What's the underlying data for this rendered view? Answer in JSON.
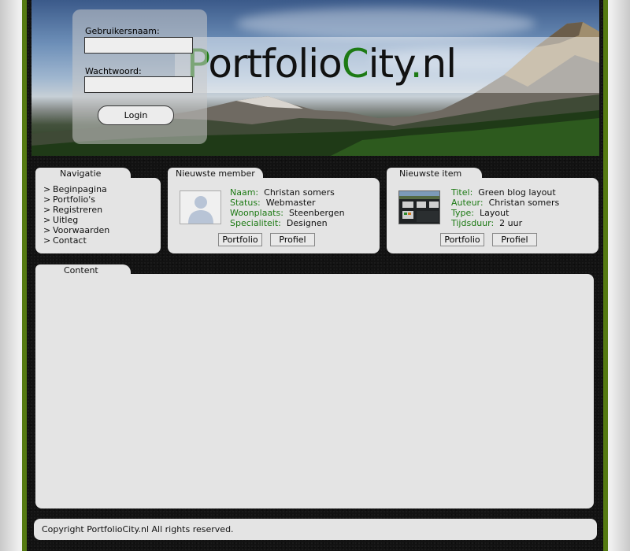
{
  "site": {
    "logo_parts": [
      "P",
      "ortfolio",
      "C",
      "ity",
      ".",
      "nl"
    ]
  },
  "login": {
    "username_label": "Gebruikersnaam:",
    "username_value": "",
    "password_label": "Wachtwoord:",
    "password_value": "",
    "button_label": "Login"
  },
  "navigation": {
    "title": "Navigatie",
    "items": [
      {
        "arrow": ">",
        "label": "Beginpagina"
      },
      {
        "arrow": ">",
        "label": "Portfolio's"
      },
      {
        "arrow": ">",
        "label": "Registreren"
      },
      {
        "arrow": ">",
        "label": "Uitleg"
      },
      {
        "arrow": ">",
        "label": "Voorwaarden"
      },
      {
        "arrow": ">",
        "label": "Contact"
      }
    ]
  },
  "newest_member": {
    "title": "Nieuwste member",
    "fields": [
      {
        "key": "Naam:",
        "value": "Christan somers"
      },
      {
        "key": "Status:",
        "value": "Webmaster"
      },
      {
        "key": "Woonplaats:",
        "value": "Steenbergen"
      },
      {
        "key": "Specialiteit:",
        "value": "Designen"
      }
    ],
    "portfolio_button": "Portfolio",
    "profile_button": "Profiel",
    "avatar_icon": "user-silhouette-icon"
  },
  "newest_item": {
    "title": "Nieuwste item",
    "fields": [
      {
        "key": "Titel:",
        "value": "Green blog layout"
      },
      {
        "key": "Auteur:",
        "value": "Christan somers"
      },
      {
        "key": "Type:",
        "value": "Layout"
      },
      {
        "key": "Tijdsduur:",
        "value": "2 uur"
      }
    ],
    "portfolio_button": "Portfolio",
    "profile_button": "Profiel"
  },
  "content": {
    "title": "Content"
  },
  "footer": {
    "copyright": "Copyright PortfolioCity.nl  All rights reserved."
  },
  "colors": {
    "accent_green": "#1d7a14",
    "frame_green": "#557a12",
    "panel_bg": "#e4e4e4",
    "page_dark": "#121212"
  }
}
